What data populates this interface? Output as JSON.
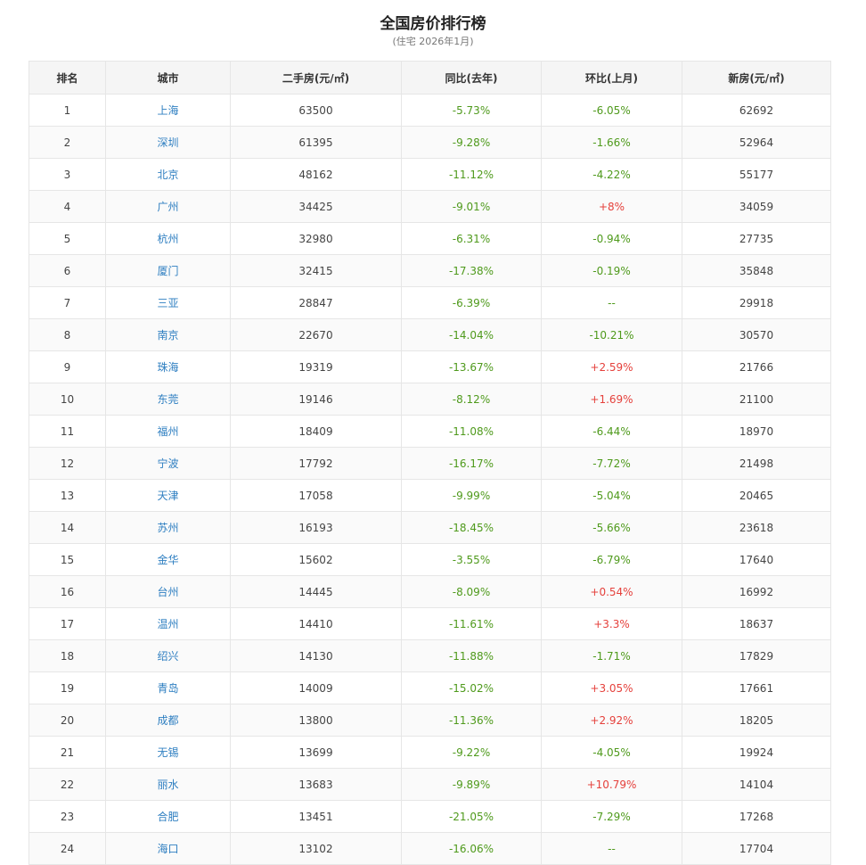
{
  "header": {
    "title": "全国房价排行榜",
    "subtitle": "(住宅 2026年1月)"
  },
  "table": {
    "columns": [
      "排名",
      "城市",
      "二手房(元/㎡)",
      "同比(去年)",
      "环比(上月)",
      "新房(元/㎡)"
    ],
    "rows": [
      {
        "rank": "1",
        "city": "上海",
        "second_hand": "63500",
        "yoy": "-5.73%",
        "mom": "-6.05%",
        "new_home": "62692"
      },
      {
        "rank": "2",
        "city": "深圳",
        "second_hand": "61395",
        "yoy": "-9.28%",
        "mom": "-1.66%",
        "new_home": "52964"
      },
      {
        "rank": "3",
        "city": "北京",
        "second_hand": "48162",
        "yoy": "-11.12%",
        "mom": "-4.22%",
        "new_home": "55177"
      },
      {
        "rank": "4",
        "city": "广州",
        "second_hand": "34425",
        "yoy": "-9.01%",
        "mom": "+8%",
        "new_home": "34059"
      },
      {
        "rank": "5",
        "city": "杭州",
        "second_hand": "32980",
        "yoy": "-6.31%",
        "mom": "-0.94%",
        "new_home": "27735"
      },
      {
        "rank": "6",
        "city": "厦门",
        "second_hand": "32415",
        "yoy": "-17.38%",
        "mom": "-0.19%",
        "new_home": "35848"
      },
      {
        "rank": "7",
        "city": "三亚",
        "second_hand": "28847",
        "yoy": "-6.39%",
        "mom": "--",
        "new_home": "29918"
      },
      {
        "rank": "8",
        "city": "南京",
        "second_hand": "22670",
        "yoy": "-14.04%",
        "mom": "-10.21%",
        "new_home": "30570"
      },
      {
        "rank": "9",
        "city": "珠海",
        "second_hand": "19319",
        "yoy": "-13.67%",
        "mom": "+2.59%",
        "new_home": "21766"
      },
      {
        "rank": "10",
        "city": "东莞",
        "second_hand": "19146",
        "yoy": "-8.12%",
        "mom": "+1.69%",
        "new_home": "21100"
      },
      {
        "rank": "11",
        "city": "福州",
        "second_hand": "18409",
        "yoy": "-11.08%",
        "mom": "-6.44%",
        "new_home": "18970"
      },
      {
        "rank": "12",
        "city": "宁波",
        "second_hand": "17792",
        "yoy": "-16.17%",
        "mom": "-7.72%",
        "new_home": "21498"
      },
      {
        "rank": "13",
        "city": "天津",
        "second_hand": "17058",
        "yoy": "-9.99%",
        "mom": "-5.04%",
        "new_home": "20465"
      },
      {
        "rank": "14",
        "city": "苏州",
        "second_hand": "16193",
        "yoy": "-18.45%",
        "mom": "-5.66%",
        "new_home": "23618"
      },
      {
        "rank": "15",
        "city": "金华",
        "second_hand": "15602",
        "yoy": "-3.55%",
        "mom": "-6.79%",
        "new_home": "17640"
      },
      {
        "rank": "16",
        "city": "台州",
        "second_hand": "14445",
        "yoy": "-8.09%",
        "mom": "+0.54%",
        "new_home": "16992"
      },
      {
        "rank": "17",
        "city": "温州",
        "second_hand": "14410",
        "yoy": "-11.61%",
        "mom": "+3.3%",
        "new_home": "18637"
      },
      {
        "rank": "18",
        "city": "绍兴",
        "second_hand": "14130",
        "yoy": "-11.88%",
        "mom": "-1.71%",
        "new_home": "17829"
      },
      {
        "rank": "19",
        "city": "青岛",
        "second_hand": "14009",
        "yoy": "-15.02%",
        "mom": "+3.05%",
        "new_home": "17661"
      },
      {
        "rank": "20",
        "city": "成都",
        "second_hand": "13800",
        "yoy": "-11.36%",
        "mom": "+2.92%",
        "new_home": "18205"
      },
      {
        "rank": "21",
        "city": "无锡",
        "second_hand": "13699",
        "yoy": "-9.22%",
        "mom": "-4.05%",
        "new_home": "19924"
      },
      {
        "rank": "22",
        "city": "丽水",
        "second_hand": "13683",
        "yoy": "-9.89%",
        "mom": "+10.79%",
        "new_home": "14104"
      },
      {
        "rank": "23",
        "city": "合肥",
        "second_hand": "13451",
        "yoy": "-21.05%",
        "mom": "-7.29%",
        "new_home": "17268"
      },
      {
        "rank": "24",
        "city": "海口",
        "second_hand": "13102",
        "yoy": "-16.06%",
        "mom": "--",
        "new_home": "17704"
      }
    ]
  },
  "colors": {
    "link": "#2f7fc1",
    "negative": "#4f9a1c",
    "positive": "#e5413c"
  }
}
